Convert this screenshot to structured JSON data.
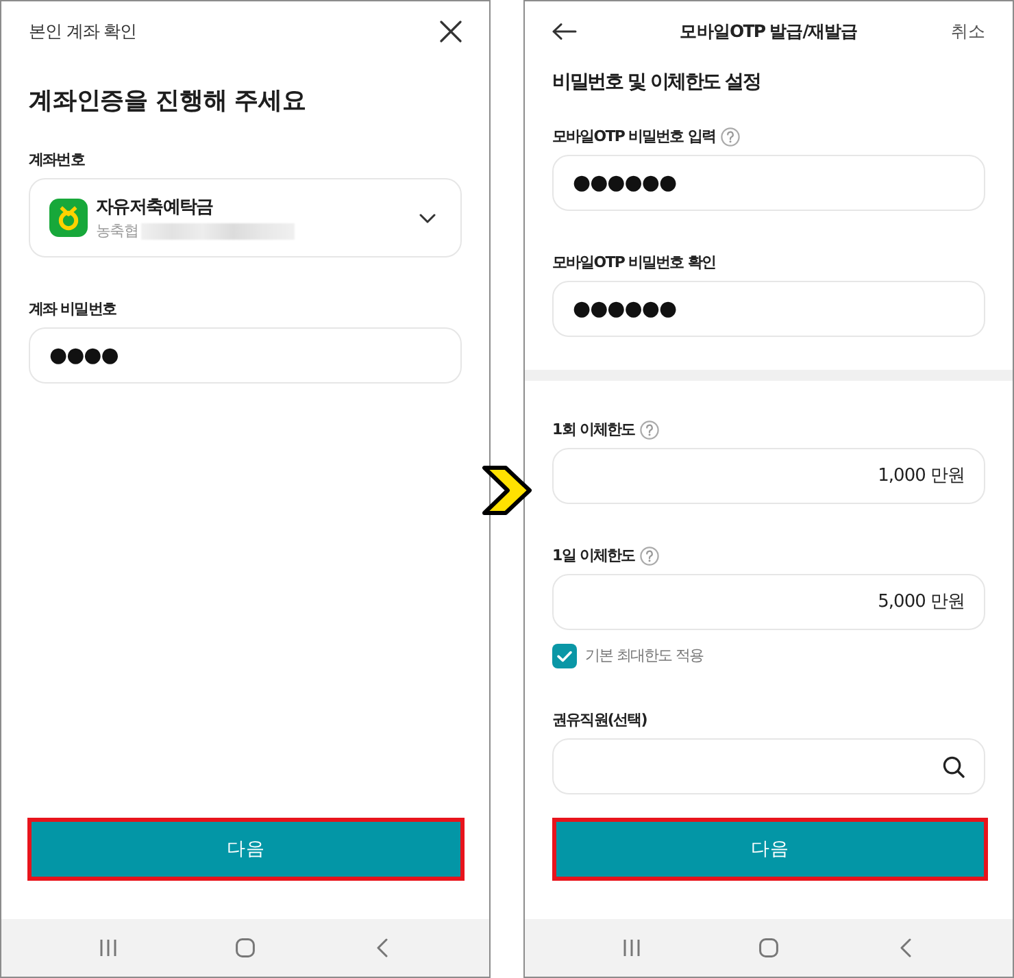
{
  "account_verification_screen": {
    "header_title": "본인 계좌 확인",
    "heading": "계좌인증을 진행해 주세요",
    "account_field": {
      "label": "계좌번호",
      "account_name": "자유저축예탁금",
      "bank_name": "농축협",
      "number_redacted": true
    },
    "password_field": {
      "label": "계좌 비밀번호",
      "value": "●●●●"
    },
    "next_button": {
      "label": "다음",
      "highlighted": true
    }
  },
  "otp_issue_screen": {
    "header": {
      "title": "모바일OTP 발급/재발급",
      "cancel": "취소"
    },
    "heading": "비밀번호 및 이체한도 설정",
    "sections": [
      {
        "fields": [
          {
            "kind": "password",
            "label": "모바일OTP 비밀번호 입력",
            "help": true,
            "value": "●●●●●●"
          },
          {
            "kind": "password",
            "label": "모바일OTP 비밀번호 확인",
            "help": false,
            "value": "●●●●●●"
          }
        ]
      },
      {
        "fields": [
          {
            "kind": "amount",
            "label": "1회 이체한도",
            "help": true,
            "value": "1,000 만원"
          },
          {
            "kind": "amount",
            "label": "1일 이체한도",
            "help": true,
            "value": "5,000 만원",
            "checkbox": {
              "label": "기본 최대한도 적용",
              "checked": true
            }
          },
          {
            "kind": "search",
            "label": "권유직원(선택)",
            "help": false
          }
        ]
      }
    ],
    "next_button": {
      "label": "다음",
      "highlighted": true
    }
  }
}
